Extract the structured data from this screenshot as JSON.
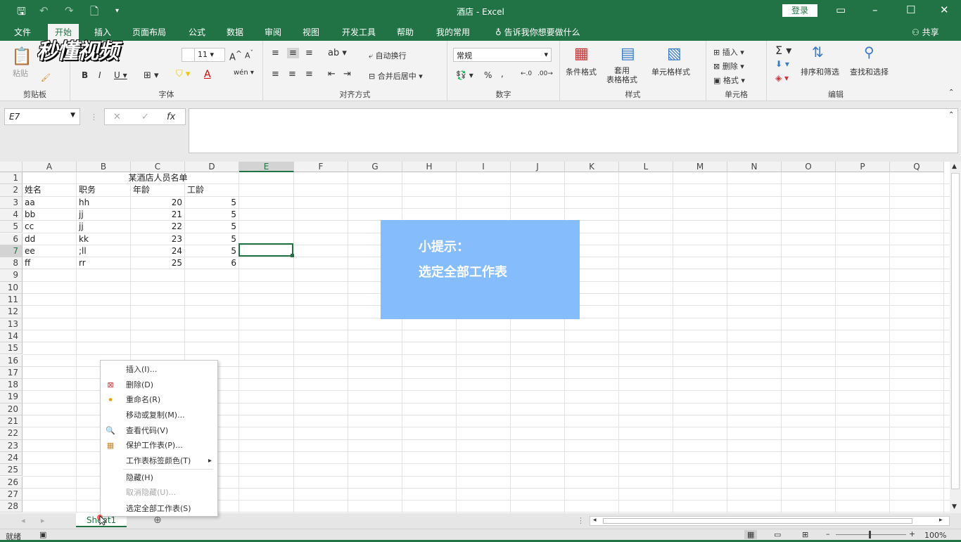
{
  "window": {
    "title": "酒店  -  Excel",
    "login": "登录"
  },
  "menu": {
    "tabs": [
      "文件",
      "开始",
      "插入",
      "页面布局",
      "公式",
      "数据",
      "审阅",
      "视图",
      "开发工具",
      "帮助",
      "我的常用"
    ],
    "tellme": "告诉我你想要做什么",
    "share": "共享"
  },
  "ribbon": {
    "clipboard": {
      "paste": "粘贴",
      "label": "剪贴板"
    },
    "font": {
      "size": "11",
      "label": "字体"
    },
    "align": {
      "wrap": "自动换行",
      "merge": "合并后居中",
      "label": "对齐方式"
    },
    "number": {
      "format": "常规",
      "label": "数字"
    },
    "styles": {
      "cond": "条件格式",
      "table": "套用\n表格格式",
      "cell": "单元格样式",
      "label": "样式"
    },
    "cells": {
      "insert": "插入",
      "delete": "删除",
      "format": "格式",
      "label": "单元格"
    },
    "edit": {
      "sort": "排序和筛选",
      "find": "查找和选择",
      "label": "编辑"
    }
  },
  "watermark": "秒懂视频",
  "formula": {
    "namebox": "E7"
  },
  "grid": {
    "columns": [
      "A",
      "B",
      "C",
      "D",
      "E",
      "F",
      "G",
      "H",
      "I",
      "J",
      "K",
      "L",
      "M",
      "N",
      "O",
      "P",
      "Q"
    ],
    "rows": [
      "1",
      "2",
      "3",
      "4",
      "5",
      "6",
      "7",
      "8",
      "9",
      "10",
      "11",
      "12",
      "13",
      "14",
      "15",
      "16",
      "17",
      "18",
      "19",
      "20",
      "21",
      "22",
      "23",
      "24",
      "25",
      "26",
      "27",
      "28"
    ],
    "title": "某酒店人员名单",
    "headers": [
      "姓名",
      "职务",
      "年龄",
      "工龄"
    ],
    "data": [
      [
        "aa",
        "hh",
        "20",
        "5"
      ],
      [
        "bb",
        "jj",
        "21",
        "5"
      ],
      [
        "cc",
        "jj",
        "22",
        "5"
      ],
      [
        "dd",
        "kk",
        "23",
        "5"
      ],
      [
        "ee",
        ";ll",
        "24",
        "5"
      ],
      [
        "ff",
        "rr",
        "25",
        "6"
      ]
    ]
  },
  "tip": {
    "line1": "小提示：",
    "line2": "选定全部工作表"
  },
  "context_menu": [
    {
      "label": "插入(I)...",
      "enabled": true
    },
    {
      "label": "删除(D)",
      "enabled": true
    },
    {
      "label": "重命名(R)",
      "enabled": true
    },
    {
      "label": "移动或复制(M)...",
      "enabled": true
    },
    {
      "label": "查看代码(V)",
      "enabled": true
    },
    {
      "label": "保护工作表(P)...",
      "enabled": true
    },
    {
      "label": "工作表标签颜色(T)",
      "enabled": true
    },
    {
      "label": "隐藏(H)",
      "enabled": true
    },
    {
      "label": "取消隐藏(U)...",
      "enabled": false
    },
    {
      "label": "选定全部工作表(S)",
      "enabled": true
    }
  ],
  "sheet": {
    "tab": "Sheet1"
  },
  "status": {
    "ready": "就绪",
    "zoom": "100%"
  }
}
